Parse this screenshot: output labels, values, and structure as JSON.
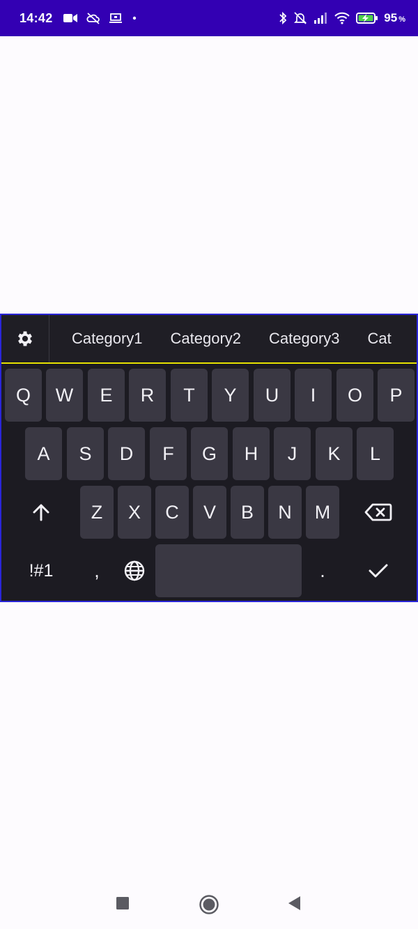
{
  "status_bar": {
    "time": "14:42",
    "battery_level": "95",
    "battery_unit": "%",
    "icons_left": [
      "video-camera-icon",
      "cloud-off-icon",
      "laptop-icon",
      "dot-icon"
    ],
    "icons_right": [
      "bluetooth-icon",
      "notifications-off-icon",
      "cellular-signal-icon",
      "wifi-icon",
      "battery-charging-icon"
    ]
  },
  "toolbar": {
    "settings_icon": "gear-icon",
    "categories": [
      "Category1",
      "Category2",
      "Category3",
      "Cat"
    ],
    "accent_color": "#e6e100"
  },
  "keyboard": {
    "row1": [
      "Q",
      "W",
      "E",
      "R",
      "T",
      "Y",
      "U",
      "I",
      "O",
      "P"
    ],
    "row2": [
      "A",
      "S",
      "D",
      "F",
      "G",
      "H",
      "J",
      "K",
      "L"
    ],
    "row3": [
      "Z",
      "X",
      "C",
      "V",
      "B",
      "N",
      "M"
    ],
    "shift_icon": "arrow-up-icon",
    "backspace_icon": "backspace-icon",
    "symbols_label": "!#1",
    "comma_label": ",",
    "language_icon": "globe-icon",
    "period_label": ".",
    "enter_icon": "checkmark-icon"
  },
  "nav_bar": {
    "icons": [
      "recents-square-icon",
      "home-circle-icon",
      "back-triangle-icon"
    ]
  },
  "colors": {
    "status_bar": "#3300b3",
    "keyboard_bg": "#1c1b22",
    "key_bg": "#3a3843",
    "key_text": "#f1f0f5",
    "border": "#2a25d8"
  }
}
